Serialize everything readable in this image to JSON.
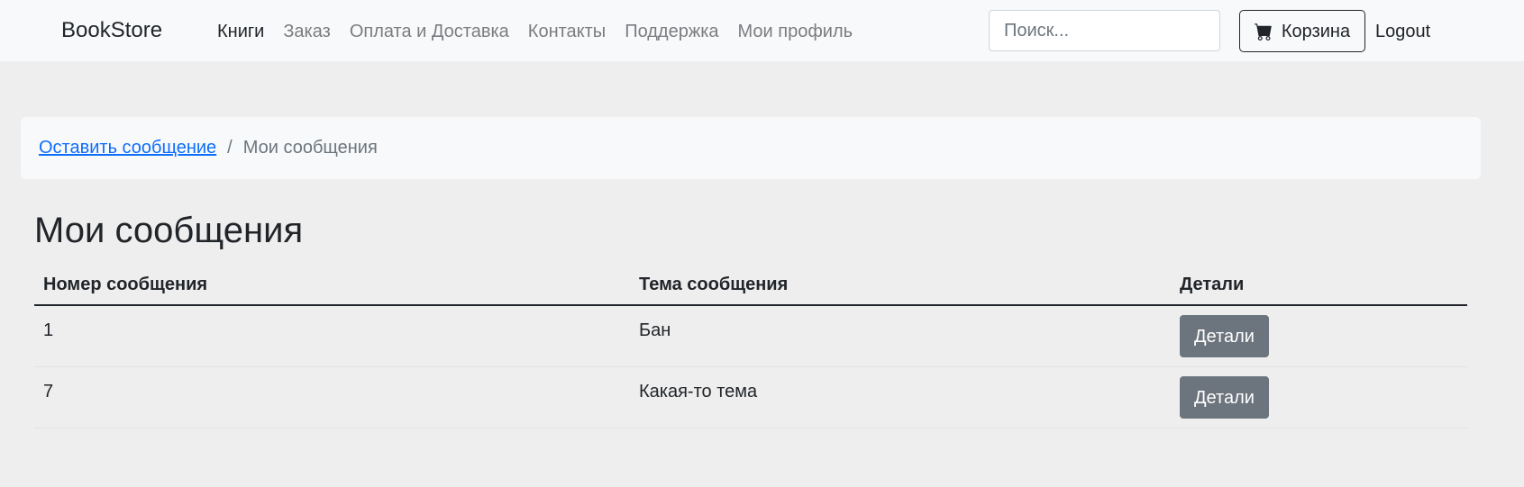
{
  "navbar": {
    "brand": "BookStore",
    "links": [
      {
        "label": "Книги",
        "active": true
      },
      {
        "label": "Заказ",
        "active": false
      },
      {
        "label": "Оплата и Доставка",
        "active": false
      },
      {
        "label": "Контакты",
        "active": false
      },
      {
        "label": "Поддержка",
        "active": false
      },
      {
        "label": "Мои профиль",
        "active": false
      }
    ],
    "search_placeholder": "Поиск...",
    "search_value": "",
    "cart_label": "Корзина",
    "cart_icon": "cart-icon",
    "logout_label": "Logout"
  },
  "breadcrumb": {
    "link_label": "Оставить сообщение",
    "separator": "/",
    "current": "Мои сообщения"
  },
  "page": {
    "title": "Мои сообщения"
  },
  "table": {
    "headers": [
      "Номер сообщения",
      "Тема сообщения",
      "Детали"
    ],
    "rows": [
      {
        "number": "1",
        "subject": "Бан",
        "details_label": "Детали"
      },
      {
        "number": "7",
        "subject": "Какая-то тема",
        "details_label": "Детали"
      }
    ]
  },
  "colors": {
    "page_background": "#eeeeee",
    "navbar_background": "#f8f9fa",
    "link_blue": "#0d6efd",
    "details_button": "#6c757d"
  }
}
